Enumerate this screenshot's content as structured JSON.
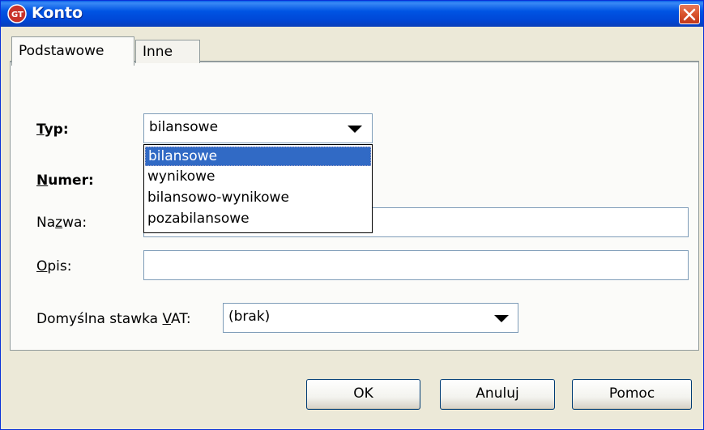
{
  "window": {
    "title": "Konto"
  },
  "tabs": [
    {
      "label": "Podstawowe",
      "active": true
    },
    {
      "label": "Inne",
      "active": false
    }
  ],
  "fields": {
    "typ": {
      "label_prefix": "",
      "label_underlined": "T",
      "label_rest": "yp:",
      "value": "bilansowe"
    },
    "numer": {
      "label_underlined": "N",
      "label_rest": "umer:"
    },
    "nazwa": {
      "label_prefix": "Na",
      "label_underlined": "z",
      "label_rest": "wa:",
      "value": ""
    },
    "opis": {
      "label_underlined": "O",
      "label_rest": "pis:",
      "value": ""
    },
    "vat": {
      "label_prefix": "Domyślna stawka ",
      "label_underlined": "V",
      "label_rest": "AT:",
      "value": "(brak)"
    }
  },
  "typ_options": [
    "bilansowe",
    "wynikowe",
    "bilansowo-wynikowe",
    "pozabilansowe"
  ],
  "typ_selected_index": 0,
  "buttons": {
    "ok": "OK",
    "cancel": "Anuluj",
    "help": "Pomoc"
  },
  "colors": {
    "titlebar": "#0054e3",
    "selection": "#316ac5",
    "close": "#d9542c"
  },
  "icons": {
    "app": "gt-app-icon",
    "close": "close-icon",
    "dropdown": "chevron-down-icon"
  }
}
